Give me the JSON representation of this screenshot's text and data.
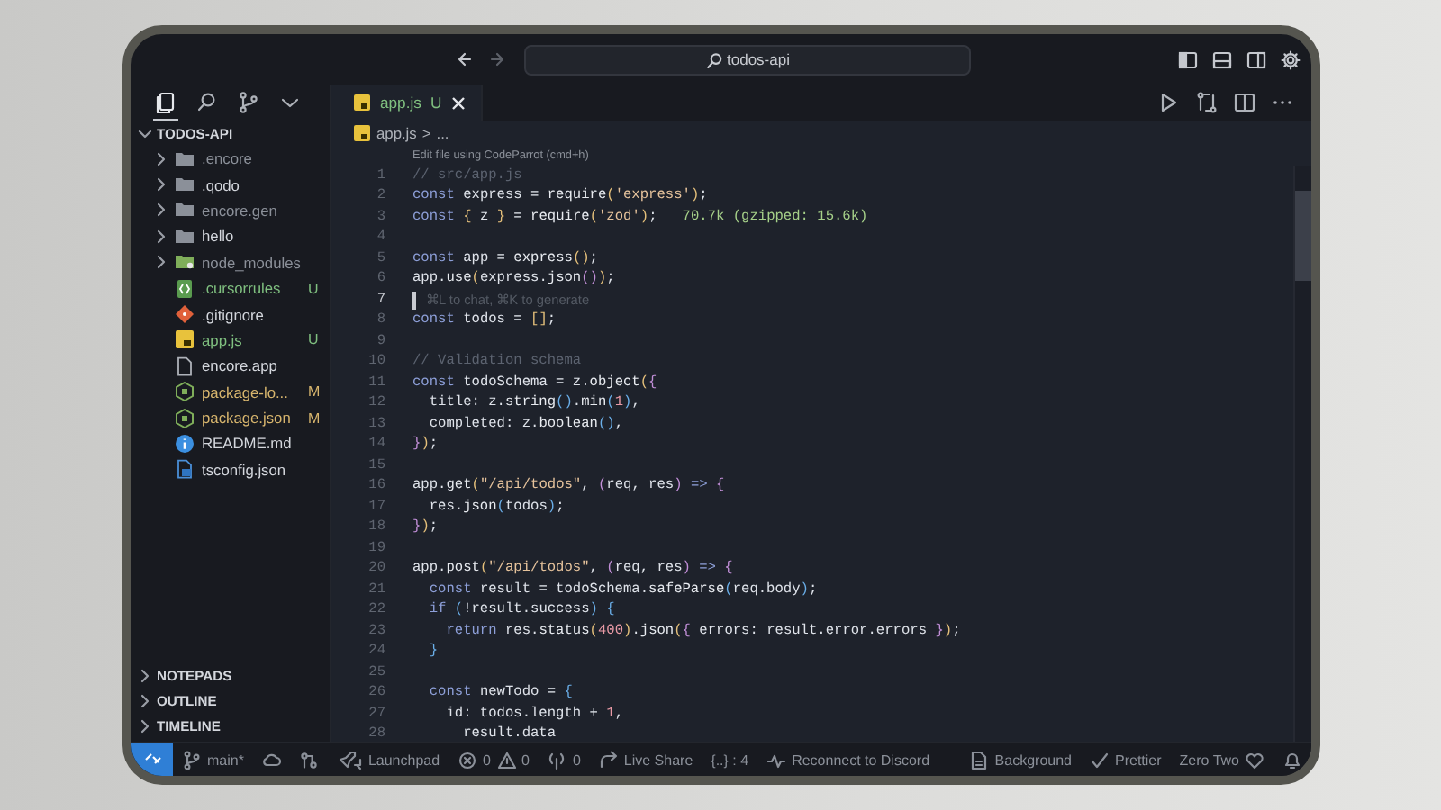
{
  "title_bar": {
    "back": {
      "disabled": false
    },
    "forward": {
      "disabled": true
    },
    "command_center": {
      "text": "todos-api"
    },
    "layout": {
      "primary_sidebar_on": true,
      "panel_on": false,
      "secondary_sidebar_on": false
    }
  },
  "activity": [
    {
      "kind": "explorer",
      "selected": true
    },
    {
      "kind": "search",
      "selected": false
    },
    {
      "kind": "source-control",
      "selected": false
    },
    {
      "kind": "more",
      "selected": false
    }
  ],
  "explorer": {
    "title": "TODOS-API",
    "expanded": true,
    "items": [
      {
        "name": ".encore",
        "kind": "folder",
        "expanded": false,
        "color": "#8b9099"
      },
      {
        "name": ".qodo",
        "kind": "folder",
        "expanded": false,
        "color": "#d4d7dd"
      },
      {
        "name": "encore.gen",
        "kind": "folder",
        "expanded": false,
        "color": "#8b9099"
      },
      {
        "name": "hello",
        "kind": "folder",
        "expanded": false,
        "color": "#d4d7dd"
      },
      {
        "name": "node_modules",
        "kind": "node-folder",
        "expanded": false,
        "color": "#8b9099"
      },
      {
        "name": ".cursorrules",
        "kind": "config",
        "status": "U",
        "color": "#7fbf7f"
      },
      {
        "name": ".gitignore",
        "kind": "git",
        "color": "#d4d7dd"
      },
      {
        "name": "app.js",
        "kind": "js",
        "status": "U",
        "color": "#7fbf7f"
      },
      {
        "name": "encore.app",
        "kind": "file",
        "color": "#d4d7dd"
      },
      {
        "name": "package-lo...",
        "kind": "node",
        "status": "M",
        "color": "#d7b56d"
      },
      {
        "name": "package.json",
        "kind": "node",
        "status": "M",
        "color": "#d7b56d"
      },
      {
        "name": "README.md",
        "kind": "info",
        "color": "#d4d7dd"
      },
      {
        "name": "tsconfig.json",
        "kind": "ts",
        "color": "#d4d7dd"
      }
    ]
  },
  "sections": [
    {
      "title": "NOTEPADS",
      "expanded": false
    },
    {
      "title": "OUTLINE",
      "expanded": false
    },
    {
      "title": "TIMELINE",
      "expanded": false
    }
  ],
  "tabs": [
    {
      "label": "app.js",
      "status": "U",
      "selected": true
    }
  ],
  "breadcrumb": {
    "file": "app.js",
    "separator": ">",
    "rest": "..."
  },
  "codelens": "Edit file using CodeParrot (cmd+h)",
  "code_lines": [
    {
      "number": "1",
      "tokens": [
        {
          "kind": "comment",
          "text": "// src/app.js"
        }
      ]
    },
    {
      "number": "2",
      "tokens": [
        {
          "kind": "keyword",
          "text": "const"
        },
        {
          "kind": "plain",
          "text": " express = "
        },
        {
          "kind": "function",
          "text": "require"
        },
        {
          "kind": "bracket",
          "text": "("
        },
        {
          "kind": "string",
          "text": "'express'"
        },
        {
          "kind": "bracket",
          "text": ")"
        },
        {
          "kind": "plain",
          "text": ";"
        }
      ]
    },
    {
      "number": "3",
      "tokens": [
        {
          "kind": "keyword",
          "text": "const"
        },
        {
          "kind": "bracket",
          "text": " {"
        },
        {
          "kind": "plain",
          "text": " z "
        },
        {
          "kind": "bracket",
          "text": "}"
        },
        {
          "kind": "plain",
          "text": " = "
        },
        {
          "kind": "function",
          "text": "require"
        },
        {
          "kind": "bracket",
          "text": "("
        },
        {
          "kind": "string",
          "text": "'zod'"
        },
        {
          "kind": "bracket",
          "text": ")"
        },
        {
          "kind": "plain",
          "text": ";"
        }
      ],
      "hint": {
        "kind": "size",
        "text": "70.7k (gzipped: 15.6k)"
      }
    },
    {
      "number": "4"
    },
    {
      "number": "5",
      "tokens": [
        {
          "kind": "keyword",
          "text": "const"
        },
        {
          "kind": "plain",
          "text": " app = "
        },
        {
          "kind": "function",
          "text": "express"
        },
        {
          "kind": "bracket",
          "text": "()"
        },
        {
          "kind": "plain",
          "text": ";"
        }
      ]
    },
    {
      "number": "6",
      "tokens": [
        {
          "kind": "plain",
          "text": "app."
        },
        {
          "kind": "function",
          "text": "use"
        },
        {
          "kind": "bracket",
          "text": "("
        },
        {
          "kind": "plain",
          "text": "express."
        },
        {
          "kind": "function",
          "text": "json"
        },
        {
          "kind": "bracket2",
          "text": "()"
        },
        {
          "kind": "bracket",
          "text": ")"
        },
        {
          "kind": "plain",
          "text": ";"
        }
      ]
    },
    {
      "number": "7",
      "cursor": true,
      "hint": {
        "kind": "ghost",
        "text": "⌘L to chat, ⌘K to generate"
      }
    },
    {
      "number": "8",
      "tokens": [
        {
          "kind": "keyword",
          "text": "const"
        },
        {
          "kind": "plain",
          "text": " todos = "
        },
        {
          "kind": "bracket",
          "text": "[]"
        },
        {
          "kind": "plain",
          "text": ";"
        }
      ]
    },
    {
      "number": "9"
    },
    {
      "number": "10",
      "tokens": [
        {
          "kind": "comment",
          "text": "// Validation schema"
        }
      ]
    },
    {
      "number": "11",
      "tokens": [
        {
          "kind": "keyword",
          "text": "const"
        },
        {
          "kind": "plain",
          "text": " todoSchema = z."
        },
        {
          "kind": "function",
          "text": "object"
        },
        {
          "kind": "bracket",
          "text": "("
        },
        {
          "kind": "bracket2",
          "text": "{"
        }
      ]
    },
    {
      "number": "12",
      "tokens": [
        {
          "kind": "plain",
          "text": "  title: z."
        },
        {
          "kind": "function",
          "text": "string"
        },
        {
          "kind": "bracket3",
          "text": "()"
        },
        {
          "kind": "plain",
          "text": "."
        },
        {
          "kind": "function",
          "text": "min"
        },
        {
          "kind": "bracket3",
          "text": "("
        },
        {
          "kind": "number",
          "text": "1"
        },
        {
          "kind": "bracket3",
          "text": ")"
        },
        {
          "kind": "plain",
          "text": ","
        }
      ]
    },
    {
      "number": "13",
      "tokens": [
        {
          "kind": "plain",
          "text": "  completed: z."
        },
        {
          "kind": "function",
          "text": "boolean"
        },
        {
          "kind": "bracket3",
          "text": "()"
        },
        {
          "kind": "plain",
          "text": ","
        }
      ]
    },
    {
      "number": "14",
      "tokens": [
        {
          "kind": "bracket2",
          "text": "}"
        },
        {
          "kind": "bracket",
          "text": ")"
        },
        {
          "kind": "plain",
          "text": ";"
        }
      ]
    },
    {
      "number": "15"
    },
    {
      "number": "16",
      "tokens": [
        {
          "kind": "plain",
          "text": "app."
        },
        {
          "kind": "function",
          "text": "get"
        },
        {
          "kind": "bracket",
          "text": "("
        },
        {
          "kind": "string",
          "text": "\"/api/todos\""
        },
        {
          "kind": "plain",
          "text": ","
        },
        {
          "kind": "bracket2",
          "text": " ("
        },
        {
          "kind": "plain",
          "text": "req, res"
        },
        {
          "kind": "bracket2",
          "text": ")"
        },
        {
          "kind": "keyword",
          "text": " =>"
        },
        {
          "kind": "bracket2",
          "text": " {"
        }
      ]
    },
    {
      "number": "17",
      "tokens": [
        {
          "kind": "plain",
          "text": "  res."
        },
        {
          "kind": "function",
          "text": "json"
        },
        {
          "kind": "bracket3",
          "text": "("
        },
        {
          "kind": "plain",
          "text": "todos"
        },
        {
          "kind": "bracket3",
          "text": ")"
        },
        {
          "kind": "plain",
          "text": ";"
        }
      ]
    },
    {
      "number": "18",
      "tokens": [
        {
          "kind": "bracket2",
          "text": "}"
        },
        {
          "kind": "bracket",
          "text": ")"
        },
        {
          "kind": "plain",
          "text": ";"
        }
      ]
    },
    {
      "number": "19"
    },
    {
      "number": "20",
      "tokens": [
        {
          "kind": "plain",
          "text": "app."
        },
        {
          "kind": "function",
          "text": "post"
        },
        {
          "kind": "bracket",
          "text": "("
        },
        {
          "kind": "string",
          "text": "\"/api/todos\""
        },
        {
          "kind": "plain",
          "text": ","
        },
        {
          "kind": "bracket2",
          "text": " ("
        },
        {
          "kind": "plain",
          "text": "req, res"
        },
        {
          "kind": "bracket2",
          "text": ")"
        },
        {
          "kind": "keyword",
          "text": " =>"
        },
        {
          "kind": "bracket2",
          "text": " {"
        }
      ]
    },
    {
      "number": "21",
      "tokens": [
        {
          "kind": "keyword",
          "text": "  const"
        },
        {
          "kind": "plain",
          "text": " result = todoSchema."
        },
        {
          "kind": "function",
          "text": "safeParse"
        },
        {
          "kind": "bracket3",
          "text": "("
        },
        {
          "kind": "plain",
          "text": "req.body"
        },
        {
          "kind": "bracket3",
          "text": ")"
        },
        {
          "kind": "plain",
          "text": ";"
        }
      ]
    },
    {
      "number": "22",
      "tokens": [
        {
          "kind": "keyword",
          "text": "  if"
        },
        {
          "kind": "bracket3",
          "text": " ("
        },
        {
          "kind": "plain",
          "text": "!result.success"
        },
        {
          "kind": "bracket3",
          "text": ") {"
        }
      ]
    },
    {
      "number": "23",
      "tokens": [
        {
          "kind": "keyword",
          "text": "    return"
        },
        {
          "kind": "plain",
          "text": " res."
        },
        {
          "kind": "function",
          "text": "status"
        },
        {
          "kind": "bracket",
          "text": "("
        },
        {
          "kind": "number",
          "text": "400"
        },
        {
          "kind": "bracket",
          "text": ")"
        },
        {
          "kind": "plain",
          "text": "."
        },
        {
          "kind": "function",
          "text": "json"
        },
        {
          "kind": "bracket",
          "text": "("
        },
        {
          "kind": "bracket2",
          "text": "{"
        },
        {
          "kind": "plain",
          "text": " errors: result.error.errors "
        },
        {
          "kind": "bracket2",
          "text": "}"
        },
        {
          "kind": "bracket",
          "text": ")"
        },
        {
          "kind": "plain",
          "text": ";"
        }
      ]
    },
    {
      "number": "24",
      "tokens": [
        {
          "kind": "bracket3",
          "text": "  }"
        }
      ]
    },
    {
      "number": "25"
    },
    {
      "number": "26",
      "tokens": [
        {
          "kind": "keyword",
          "text": "  const"
        },
        {
          "kind": "plain",
          "text": " newTodo = "
        },
        {
          "kind": "bracket3",
          "text": "{"
        }
      ]
    },
    {
      "number": "27",
      "tokens": [
        {
          "kind": "plain",
          "text": "    id: todos.length + "
        },
        {
          "kind": "number",
          "text": "1"
        },
        {
          "kind": "plain",
          "text": ","
        }
      ]
    },
    {
      "number": "28",
      "tokens": [
        {
          "kind": "plain",
          "text": "      result.data"
        }
      ]
    }
  ],
  "status_left": [
    {
      "kind": "remote"
    },
    {
      "kind": "branch",
      "text": "main*"
    },
    {
      "kind": "sync"
    },
    {
      "kind": "graph"
    },
    {
      "kind": "launchpad",
      "text": "Launchpad"
    },
    {
      "kind": "problems",
      "errors": "0",
      "warnings": "0"
    },
    {
      "kind": "ports",
      "text": "0"
    },
    {
      "kind": "liveshare",
      "text": "Live Share"
    },
    {
      "kind": "plain",
      "text": "{..} : 4"
    },
    {
      "kind": "discord",
      "text": "Reconnect to Discord"
    }
  ],
  "status_right": [
    {
      "kind": "background",
      "text": "Background"
    },
    {
      "kind": "prettier",
      "text": "Prettier"
    },
    {
      "kind": "profile",
      "text": "Zero Two"
    },
    {
      "kind": "bell"
    }
  ]
}
